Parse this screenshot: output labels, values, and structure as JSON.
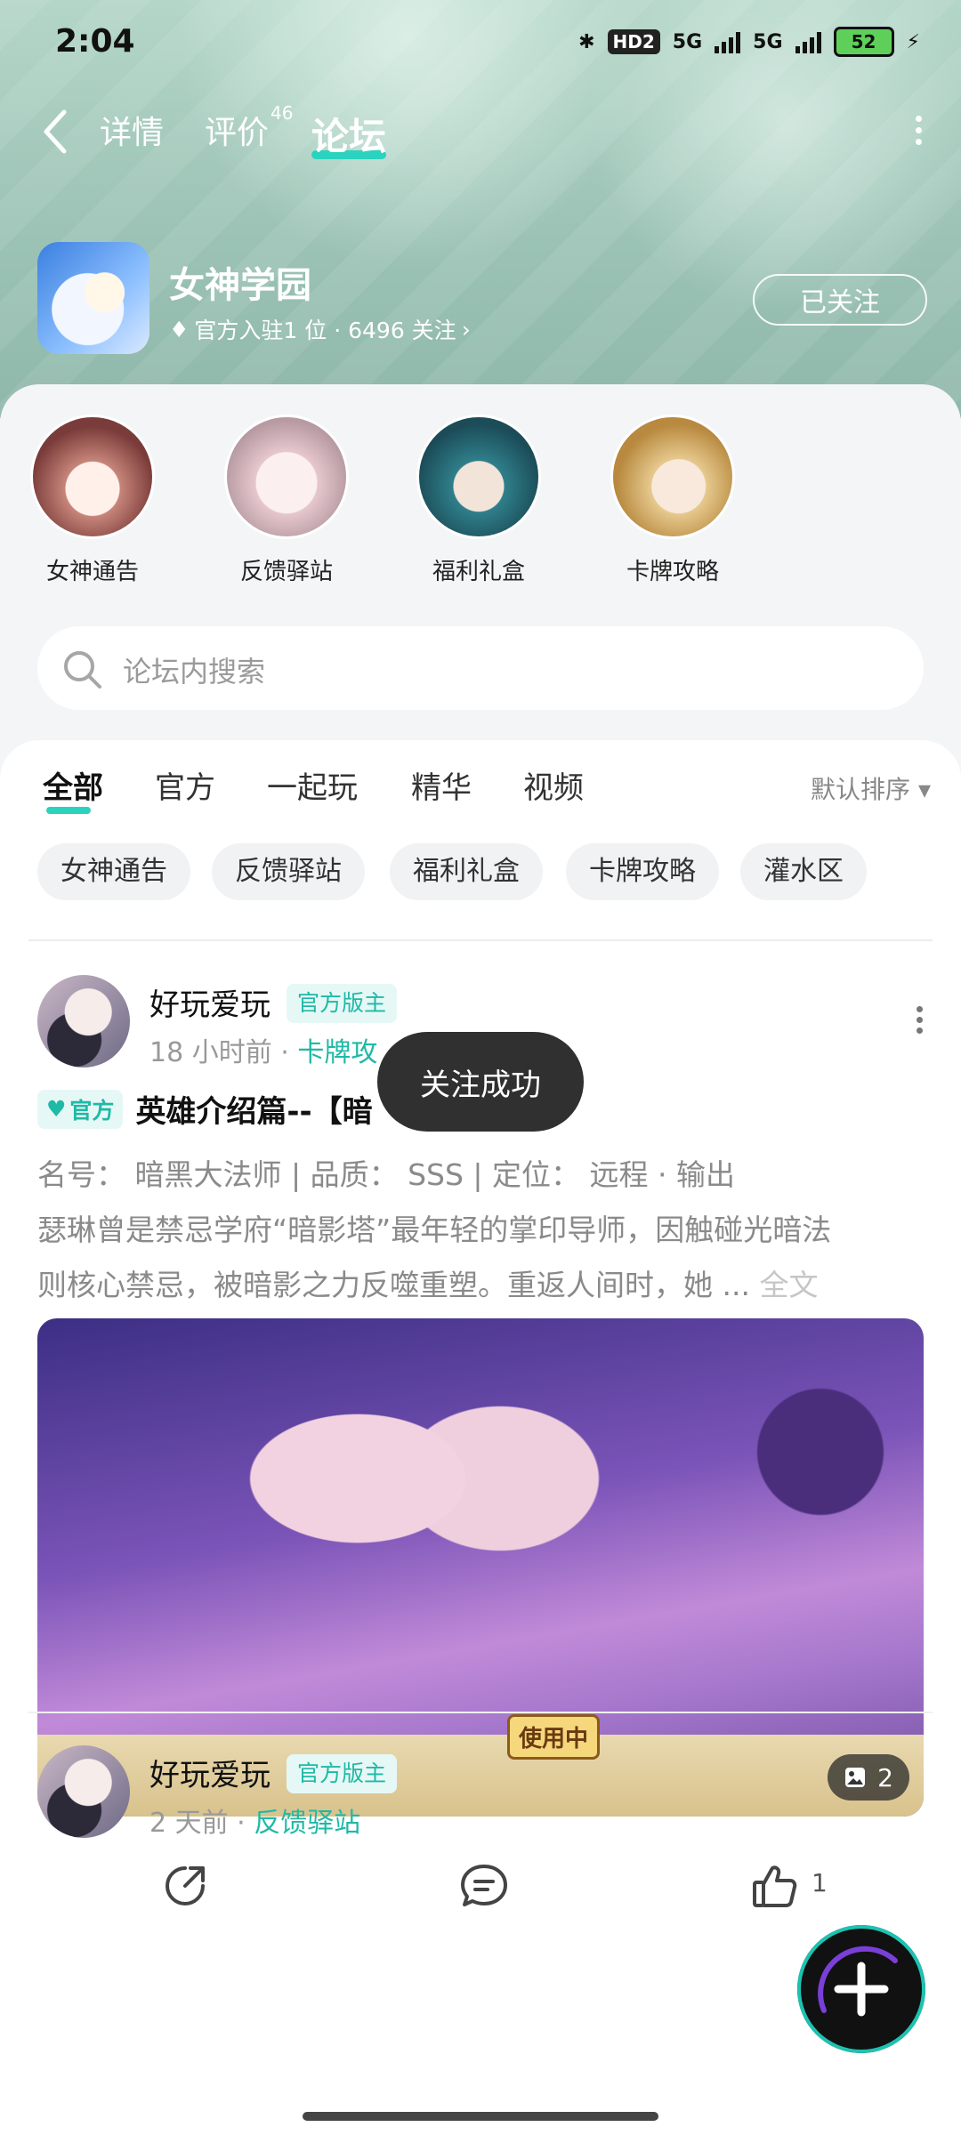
{
  "status_bar": {
    "time": "2:04",
    "hd": "HD2",
    "net1": "5G",
    "net2": "5G",
    "battery": "52"
  },
  "nav": {
    "tabs": [
      {
        "label": "详情"
      },
      {
        "label": "评价",
        "badge": "46"
      },
      {
        "label": "论坛"
      }
    ],
    "active_tab": "论坛"
  },
  "app": {
    "name": "女神学园",
    "meta": "官方入驻1 位 · 6496 关注",
    "follow_label": "已关注"
  },
  "circles": [
    {
      "label": "女神通告",
      "color": "#c7857a"
    },
    {
      "label": "反馈驿站",
      "color": "#e6c7cd"
    },
    {
      "label": "福利礼盒",
      "color": "#2f7f8a"
    },
    {
      "label": "卡牌攻略",
      "color": "#e6c98e"
    }
  ],
  "search": {
    "placeholder": "论坛内搜索"
  },
  "feed": {
    "tabs": [
      "全部",
      "官方",
      "一起玩",
      "精华",
      "视频"
    ],
    "active_tab": "全部",
    "sort_label": "默认排序",
    "chips": [
      "女神通告",
      "反馈驿站",
      "福利礼盒",
      "卡牌攻略",
      "灌水区"
    ]
  },
  "posts": [
    {
      "author": "好玩爱玩",
      "badge": "官方版主",
      "time": "18 小时前",
      "category": "卡牌攻",
      "official_tag": "官方",
      "title": "英雄介绍篇--【暗",
      "body_line1": "名号：  暗黑大法师 | 品质：  SSS | 定位：  远程 · 输出",
      "body_line2": "瑟琳曾是禁忌学府“暗影塔”最年轻的掌印导师，因触碰光暗法",
      "body_line3": "则核心禁忌，被暗影之力反噬重塑。重返人间时，她 ... ",
      "full_text": "全文",
      "image_label": "使用中",
      "image_count": "2",
      "likes": "1"
    },
    {
      "author": "好玩爱玩",
      "badge": "官方版主",
      "time": "2 天前",
      "category": "反馈驿站"
    }
  ],
  "toast": "关注成功",
  "colors": {
    "accent": "#2bd3bf",
    "accent_text": "#1fb9a6"
  }
}
